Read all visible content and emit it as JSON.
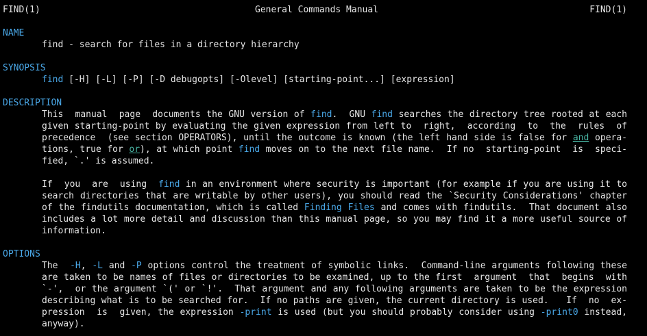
{
  "header": {
    "left": "FIND(1)",
    "center": "General Commands Manual",
    "right": "FIND(1)"
  },
  "sections": {
    "name": {
      "title": "NAME",
      "text": "find - search for files in a directory hierarchy"
    },
    "synopsis": {
      "title": "SYNOPSIS",
      "cmd": "find",
      "rest": " [-H] [-L] [-P] [-D debugopts] [-Olevel] [starting-point...] [expression]"
    },
    "description": {
      "title": "DESCRIPTION",
      "p1": {
        "l1a": "This  manual  page  documents the GNU version of ",
        "l1b": "find",
        "l1c": ".  GNU ",
        "l1d": "find",
        "l1e": " searches the directory tree rooted at each",
        "l2": "given starting-point by evaluating the given expression from left to  right,  according  to  the  rules  of",
        "l3a": "precedence  (see section OPERATORS), until the outcome is known (the left hand side is false for ",
        "l3b": "and",
        "l3c": " opera-",
        "l4a": "tions, true for ",
        "l4b": "or",
        "l4c": "), at which point ",
        "l4d": "find",
        "l4e": " moves on to the next file name.  If no  starting-point  is  speci-",
        "l5": "fied, `.' is assumed."
      },
      "p2": {
        "l1a": "If  you  are  using  ",
        "l1b": "find",
        "l1c": " in an environment where security is important (for example if you are using it to",
        "l2": "search directories that are writable by other users), you should read the `Security Considerations' chapter",
        "l3a": "of the findutils documentation, which is called ",
        "l3b": "Finding Files",
        "l3c": " and comes with findutils.  That document also",
        "l4": "includes a lot more detail and discussion than this manual page, so you may find it a more useful source of",
        "l5": "information."
      }
    },
    "options": {
      "title": "OPTIONS",
      "l1a": "The  ",
      "l1b": "-H",
      "l1c": ", ",
      "l1d": "-L",
      "l1e": " and ",
      "l1f": "-P",
      "l1g": " options control the treatment of symbolic links.  Command-line arguments following these",
      "l2": "are taken to be names of files or directories to be examined, up to the first  argument  that  begins  with",
      "l3": "`-',  or the argument `(' or `!'.  That argument and any following arguments are taken to be the expression",
      "l4": "describing what is to be searched for.  If no paths are given, the current directory is used.   If  no  ex-",
      "l5a": "pression  is  given, the expression ",
      "l5b": "-print",
      "l5c": " is used (but you should probably consider using ",
      "l5d": "-print0",
      "l5e": " instead,",
      "l6": "anyway)."
    }
  },
  "colors": {
    "background": "#000000",
    "text": "#e6e6e6",
    "bold": "#4aa8e8",
    "underline": "#49b7a5"
  }
}
